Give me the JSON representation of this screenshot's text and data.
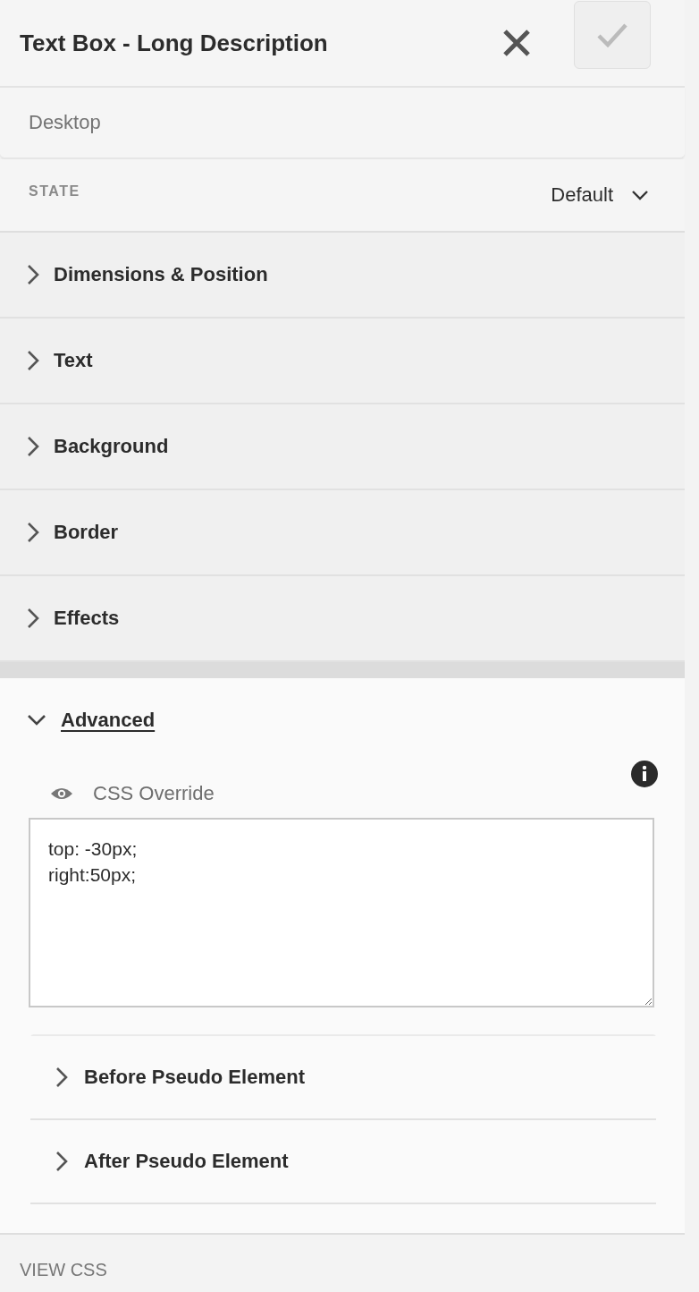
{
  "header": {
    "title": "Text Box - Long Description",
    "confirm_disabled": true
  },
  "breakpoint": {
    "value": "Desktop"
  },
  "state": {
    "label": "STATE",
    "value": "Default"
  },
  "sections": [
    {
      "label": "Dimensions & Position",
      "expanded": false
    },
    {
      "label": "Text",
      "expanded": false
    },
    {
      "label": "Background",
      "expanded": false
    },
    {
      "label": "Border",
      "expanded": false
    },
    {
      "label": "Effects",
      "expanded": false
    },
    {
      "label": "Advanced",
      "expanded": true,
      "css_override": {
        "label": "CSS Override",
        "value": "top: -30px;\nright:50px;"
      },
      "subsections": [
        {
          "label": "Before Pseudo Element",
          "expanded": false
        },
        {
          "label": "After Pseudo Element",
          "expanded": false
        }
      ]
    }
  ],
  "footer": {
    "link": "VIEW CSS"
  }
}
